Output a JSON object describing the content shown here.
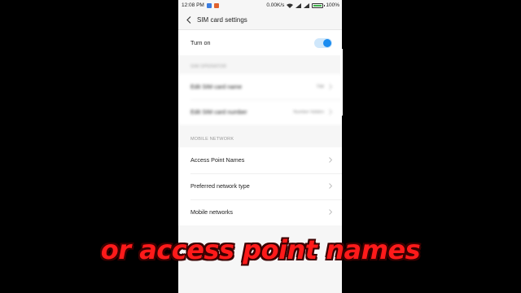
{
  "status_bar": {
    "time": "12:08 PM",
    "speed": "0.00K/s",
    "battery": "100%",
    "battery_level": 1.0
  },
  "header": {
    "title": "SIM card settings"
  },
  "turn_on": {
    "label": "Turn on",
    "enabled": true
  },
  "sim_section": {
    "header": "SIM OPERATOR",
    "name_label": "Edit SIM card name",
    "name_value": "TIM",
    "number_label": "Edit SIM card number",
    "number_value": "Number hidden"
  },
  "mobile_network": {
    "header": "MOBILE NETWORK",
    "items": [
      {
        "label": "Access Point Names"
      },
      {
        "label": "Preferred network type"
      },
      {
        "label": "Mobile networks"
      }
    ]
  },
  "caption": "or access point names",
  "colors": {
    "accent": "#1a8cf0",
    "caption": "#ff1a1a"
  }
}
